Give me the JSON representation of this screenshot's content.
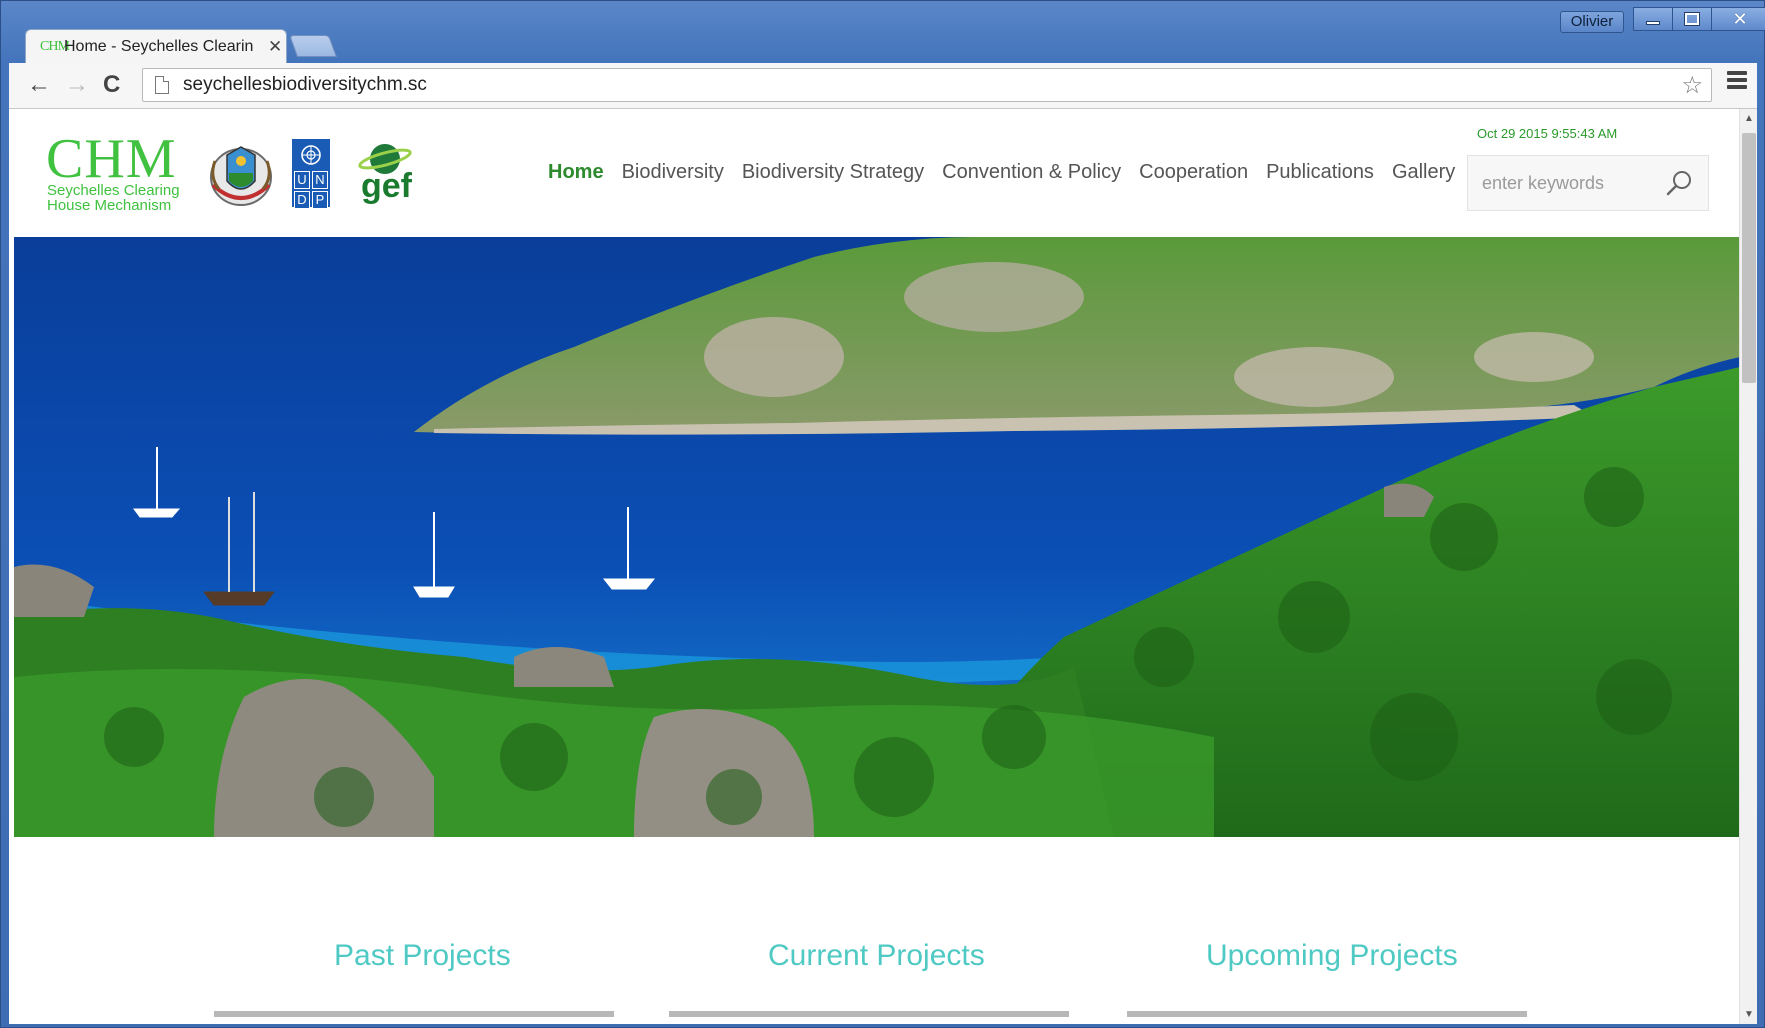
{
  "window": {
    "user": "Olivier",
    "tab_title": "Home - Seychelles Clearin",
    "tab_favicon": "CHM",
    "icons": {
      "minimize": "minimize-icon",
      "maximize": "maximize-icon",
      "close": "close-icon"
    }
  },
  "toolbar": {
    "url": "seychellesbiodiversitychm.sc",
    "icons": {
      "back": "←",
      "forward": "→",
      "reload": "C",
      "star": "☆"
    }
  },
  "site": {
    "logo_title": "CHM",
    "logo_line1": "Seychelles Clearing",
    "logo_line2": "House Mechanism",
    "undp_cells": [
      "U",
      "N",
      "D",
      "P"
    ],
    "gef_label": "gef",
    "datetime": "Oct 29 2015 9:55:43 AM",
    "nav": [
      {
        "label": "Home",
        "active": true
      },
      {
        "label": "Biodiversity",
        "active": false
      },
      {
        "label": "Biodiversity Strategy",
        "active": false
      },
      {
        "label": "Convention & Policy",
        "active": false
      },
      {
        "label": "Cooperation",
        "active": false
      },
      {
        "label": "Publications",
        "active": false
      },
      {
        "label": "Gallery",
        "active": false
      }
    ],
    "search_placeholder": "enter keywords"
  },
  "projects": {
    "past": "Past Projects",
    "current": "Current Projects",
    "upcoming": "Upcoming Projects"
  },
  "colors": {
    "brand_green": "#40c240",
    "nav_active": "#2d8a2d",
    "project_heading": "#4fc9c3",
    "window_frame": "#4474bb"
  }
}
